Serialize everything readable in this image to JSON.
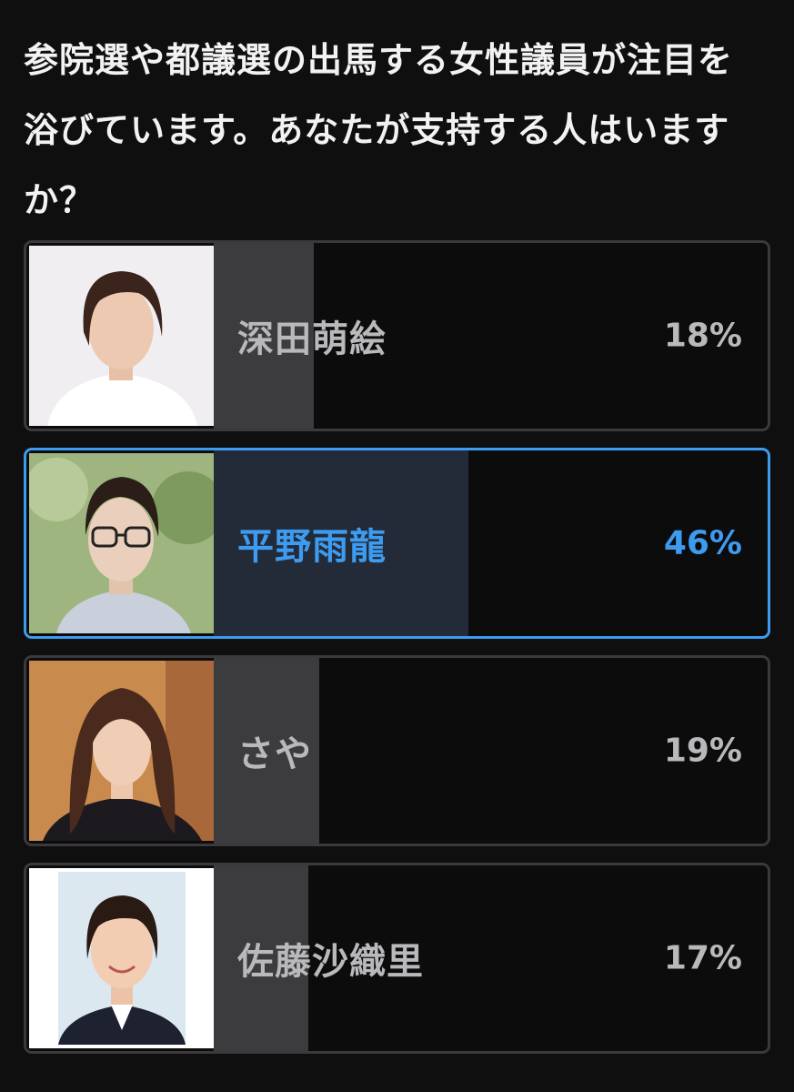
{
  "poll": {
    "question": "参院選や都議選の出馬する女性議員が注目を浴びています。あなたが支持する人はいますか？",
    "options": [
      {
        "name": "深田萌絵",
        "percent_label": "18%",
        "percent": 18,
        "selected": false,
        "photo": "woman-short-hair-portrait"
      },
      {
        "name": "平野雨龍",
        "percent_label": "46%",
        "percent": 46,
        "selected": true,
        "photo": "woman-glasses-portrait"
      },
      {
        "name": "さや",
        "percent_label": "19%",
        "percent": 19,
        "selected": false,
        "photo": "woman-long-hair-portrait"
      },
      {
        "name": "佐藤沙織里",
        "percent_label": "17%",
        "percent": 17,
        "selected": false,
        "photo": "woman-smiling-portrait"
      }
    ]
  },
  "colors": {
    "background": "#0f0f10",
    "border": "#3a3a3d",
    "bar_fill": "#3c3c3e",
    "selected_accent": "#3d9bf0",
    "selected_bar_fill": "#232a38",
    "text_muted": "#b9b9bb"
  }
}
